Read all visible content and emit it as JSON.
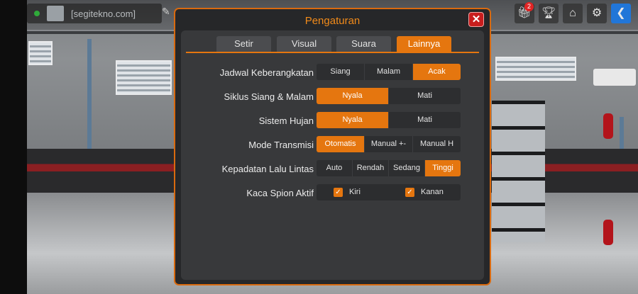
{
  "hud": {
    "player_name": "[segitekno.com]",
    "notification_count": "2",
    "icons": [
      "gift-icon",
      "trophy-icon",
      "garage-icon",
      "gear-icon",
      "back-arrow-icon"
    ]
  },
  "dialog": {
    "title": "Pengaturan",
    "close_icon": "close-icon",
    "tabs": [
      {
        "label": "Setir",
        "active": false
      },
      {
        "label": "Visual",
        "active": false
      },
      {
        "label": "Suara",
        "active": false
      },
      {
        "label": "Lainnya",
        "active": true
      }
    ],
    "settings": [
      {
        "label": "Jadwal Keberangkatan",
        "options": [
          "Siang",
          "Malam",
          "Acak"
        ],
        "selected": "Acak"
      },
      {
        "label": "Siklus Siang & Malam",
        "options": [
          "Nyala",
          "Mati"
        ],
        "selected": "Nyala"
      },
      {
        "label": "Sistem Hujan",
        "options": [
          "Nyala",
          "Mati"
        ],
        "selected": "Nyala"
      },
      {
        "label": "Mode Transmisi",
        "options": [
          "Otomatis",
          "Manual +-",
          "Manual H"
        ],
        "selected": "Otomatis"
      },
      {
        "label": "Kepadatan Lalu Lintas",
        "options": [
          "Auto",
          "Rendah",
          "Sedang",
          "Tinggi"
        ],
        "selected": "Tinggi"
      }
    ],
    "mirrors": {
      "label": "Kaca Spion Aktif",
      "left": {
        "label": "Kiri",
        "checked": true
      },
      "right": {
        "label": "Kanan",
        "checked": true
      }
    }
  },
  "colors": {
    "accent": "#e5760f",
    "title": "#f08a1a",
    "close": "#c81d1d",
    "back_button": "#2176d8"
  }
}
